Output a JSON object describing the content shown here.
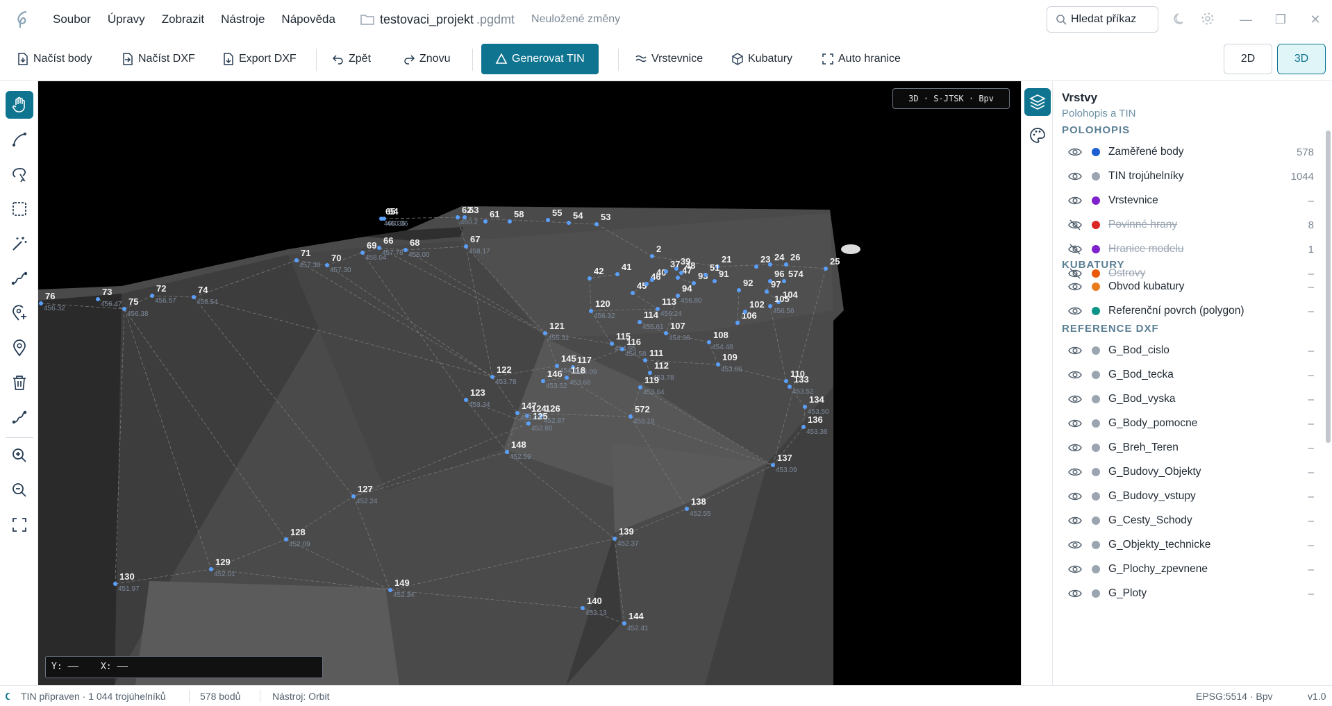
{
  "menu": [
    "Soubor",
    "Úpravy",
    "Zobrazit",
    "Nástroje",
    "Nápověda"
  ],
  "project": {
    "name": "testovaci_projekt",
    "ext": ".pgdmt",
    "state": "Neuložené změny"
  },
  "search": {
    "label": "Hledat příkaz"
  },
  "toolbar": {
    "load_points": "Načíst body",
    "load_dxf": "Načíst DXF",
    "export_dxf": "Export DXF",
    "undo": "Zpět",
    "redo": "Znovu",
    "generate_tin": "Generovat TIN",
    "contours": "Vrstevnice",
    "volumes": "Kubatury",
    "auto_boundary": "Auto hranice",
    "view_2d": "2D",
    "view_3d": "3D"
  },
  "viewport": {
    "badge": "3D · S-JTSK · Bpv",
    "coord_y": "Y: ——",
    "coord_x": "X: ——"
  },
  "panel": {
    "title": "Vrstvy",
    "subtitle": "Polohopis a TIN",
    "sections": [
      {
        "title": "POLOHOPIS",
        "rows": [
          {
            "name": "Zaměřené body",
            "count": "578",
            "color": "#1d5fd1",
            "visible": true
          },
          {
            "name": "TIN trojúhelníky",
            "count": "1044",
            "color": "#9aa5b1",
            "visible": true
          },
          {
            "name": "Vrstevnice",
            "count": "–",
            "color": "#7e22ce",
            "visible": true
          },
          {
            "name": "Povinné hrany",
            "count": "8",
            "color": "#dc2626",
            "visible": false
          },
          {
            "name": "Hranice modelu",
            "count": "1",
            "color": "#7e22ce",
            "visible": false
          },
          {
            "name": "Ostrovy",
            "count": "–",
            "color": "#ea580c",
            "visible": false
          }
        ]
      },
      {
        "title": "KUBATURY",
        "rows": [
          {
            "name": "Obvod kubatury",
            "count": "–",
            "color": "#ea7b1c",
            "visible": true
          },
          {
            "name": "Referenční povrch (polygon)",
            "count": "–",
            "color": "#0d9488",
            "visible": true
          }
        ]
      },
      {
        "title": "REFERENCE DXF",
        "rows": [
          {
            "name": "G_Bod_cislo",
            "count": "–",
            "color": "#9aa5b1",
            "visible": true
          },
          {
            "name": "G_Bod_tecka",
            "count": "–",
            "color": "#9aa5b1",
            "visible": true
          },
          {
            "name": "G_Bod_vyska",
            "count": "–",
            "color": "#9aa5b1",
            "visible": true
          },
          {
            "name": "G_Body_pomocne",
            "count": "–",
            "color": "#9aa5b1",
            "visible": true
          },
          {
            "name": "G_Breh_Teren",
            "count": "–",
            "color": "#9aa5b1",
            "visible": true
          },
          {
            "name": "G_Budovy_Objekty",
            "count": "–",
            "color": "#9aa5b1",
            "visible": true
          },
          {
            "name": "G_Budovy_vstupy",
            "count": "–",
            "color": "#9aa5b1",
            "visible": true
          },
          {
            "name": "G_Cesty_Schody",
            "count": "–",
            "color": "#9aa5b1",
            "visible": true
          },
          {
            "name": "G_Objekty_technicke",
            "count": "–",
            "color": "#9aa5b1",
            "visible": true
          },
          {
            "name": "G_Plochy_zpevnene",
            "count": "–",
            "color": "#9aa5b1",
            "visible": true
          },
          {
            "name": "G_Ploty",
            "count": "–",
            "color": "#9aa5b1",
            "visible": true
          }
        ]
      }
    ]
  },
  "status": {
    "state": "TIN připraven · 1 044 trojúhelníků",
    "points": "578  bodů",
    "tool": "Nástroj: Orbit",
    "epsg": "EPSG:5514  ·  Bpv",
    "version": "v1.0"
  },
  "scene_points": [
    {
      "id": "76",
      "h": "456.32"
    },
    {
      "id": "73",
      "h": "456.47"
    },
    {
      "id": "75",
      "h": "456.38"
    },
    {
      "id": "72",
      "h": "456.57"
    },
    {
      "id": "74",
      "h": "456.54"
    },
    {
      "id": "71",
      "h": "457.38"
    },
    {
      "id": "70",
      "h": "457.30"
    },
    {
      "id": "69",
      "h": "458.04"
    },
    {
      "id": "66",
      "h": "457.78"
    },
    {
      "id": "68",
      "h": "458.00"
    },
    {
      "id": "67",
      "h": "458.17"
    },
    {
      "id": "65",
      "h": "460.36"
    },
    {
      "id": "64",
      "h": "460.36"
    },
    {
      "id": "62",
      "h": "460.2"
    },
    {
      "id": "63",
      "h": ""
    },
    {
      "id": "61",
      "h": ""
    },
    {
      "id": "58",
      "h": ""
    },
    {
      "id": "55",
      "h": ""
    },
    {
      "id": "54",
      "h": ""
    },
    {
      "id": "53",
      "h": ""
    },
    {
      "id": "121",
      "h": "455.31"
    },
    {
      "id": "120",
      "h": "456.32"
    },
    {
      "id": "115",
      "h": "454.95"
    },
    {
      "id": "116",
      "h": "454.58"
    },
    {
      "id": "114",
      "h": "455.61"
    },
    {
      "id": "113",
      "h": "456.24"
    },
    {
      "id": "107",
      "h": "454.68"
    },
    {
      "id": "108",
      "h": "454.48"
    },
    {
      "id": "109",
      "h": "453.86"
    },
    {
      "id": "111",
      "h": ""
    },
    {
      "id": "112",
      "h": "453.78"
    },
    {
      "id": "119",
      "h": "453.64"
    },
    {
      "id": "117",
      "h": "454.09"
    },
    {
      "id": "118",
      "h": "453.66"
    },
    {
      "id": "145",
      "h": "454.11"
    },
    {
      "id": "146",
      "h": "453.52"
    },
    {
      "id": "122",
      "h": "453.78"
    },
    {
      "id": "123",
      "h": "453.34"
    },
    {
      "id": "124",
      "h": ""
    },
    {
      "id": "126",
      "h": "452.87"
    },
    {
      "id": "125",
      "h": "452.80"
    },
    {
      "id": "147",
      "h": "453.01"
    },
    {
      "id": "572",
      "h": "453.18"
    },
    {
      "id": "148",
      "h": "452.59"
    },
    {
      "id": "110",
      "h": ""
    },
    {
      "id": "133",
      "h": "453.52"
    },
    {
      "id": "134",
      "h": "453.50"
    },
    {
      "id": "136",
      "h": "453.36"
    },
    {
      "id": "137",
      "h": "453.09"
    },
    {
      "id": "127",
      "h": "452.24"
    },
    {
      "id": "128",
      "h": "452.09"
    },
    {
      "id": "129",
      "h": "452.01"
    },
    {
      "id": "130",
      "h": "451.97"
    },
    {
      "id": "149",
      "h": "452.34"
    },
    {
      "id": "138",
      "h": "452.55"
    },
    {
      "id": "139",
      "h": "452.37"
    },
    {
      "id": "140",
      "h": "452.13"
    },
    {
      "id": "144",
      "h": "452.41"
    },
    {
      "id": "42",
      "h": ""
    },
    {
      "id": "41",
      "h": ""
    },
    {
      "id": "45",
      "h": ""
    },
    {
      "id": "46",
      "h": ""
    },
    {
      "id": "40",
      "h": ""
    },
    {
      "id": "47",
      "h": ""
    },
    {
      "id": "39",
      "h": ""
    },
    {
      "id": "94",
      "h": "456.80"
    },
    {
      "id": "93",
      "h": ""
    },
    {
      "id": "92",
      "h": ""
    },
    {
      "id": "96",
      "h": ""
    },
    {
      "id": "97",
      "h": ""
    },
    {
      "id": "104",
      "h": ""
    },
    {
      "id": "105",
      "h": "456.56"
    },
    {
      "id": "106",
      "h": ""
    },
    {
      "id": "102",
      "h": ""
    },
    {
      "id": "21",
      "h": ""
    },
    {
      "id": "24",
      "h": ""
    },
    {
      "id": "26",
      "h": ""
    },
    {
      "id": "23",
      "h": ""
    },
    {
      "id": "25",
      "h": ""
    },
    {
      "id": "574",
      "h": ""
    },
    {
      "id": "91",
      "h": ""
    },
    {
      "id": "48",
      "h": ""
    },
    {
      "id": "51",
      "h": ""
    },
    {
      "id": "2",
      "h": ""
    },
    {
      "id": "37",
      "h": ""
    }
  ]
}
